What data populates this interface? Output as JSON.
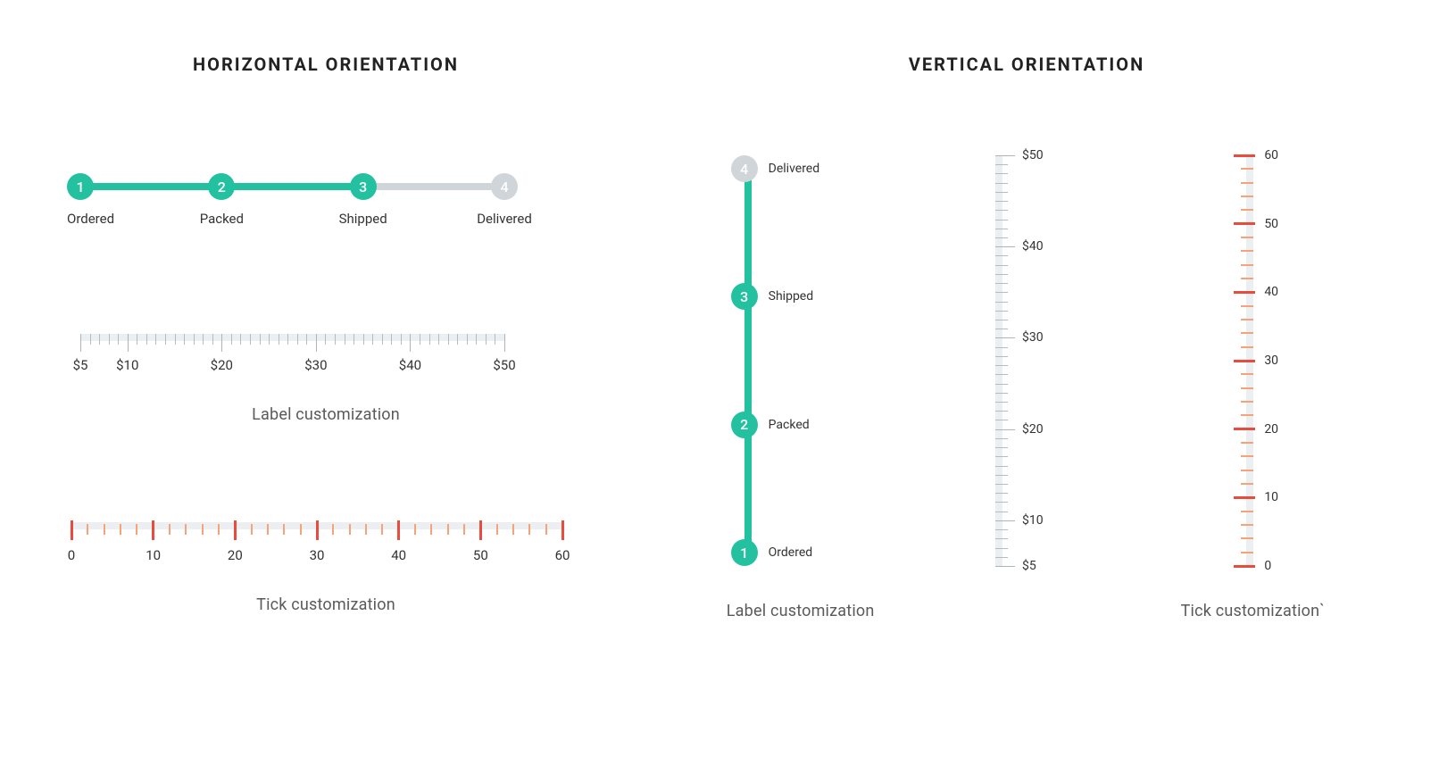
{
  "titles": {
    "horizontal": "HORIZONTAL ORIENTATION",
    "vertical": "VERTICAL ORIENTATION"
  },
  "captions": {
    "labelCustom": "Label customization",
    "tickCustom": "Tick customization",
    "tickCustomBacktick": "Tick customization`"
  },
  "stepperH": {
    "activeIndex": 3,
    "steps": [
      {
        "num": "1",
        "label": "Ordered"
      },
      {
        "num": "2",
        "label": "Packed"
      },
      {
        "num": "3",
        "label": "Shipped"
      },
      {
        "num": "4",
        "label": "Delivered"
      }
    ]
  },
  "rulerH_labels": [
    "$5",
    "$10",
    "$20",
    "$30",
    "$40",
    "$50"
  ],
  "rulerH_values": [
    5,
    10,
    20,
    30,
    40,
    50
  ],
  "rulerH_range": [
    5,
    50
  ],
  "rulerH2_labels": [
    "0",
    "10",
    "20",
    "30",
    "40",
    "50",
    "60"
  ],
  "rulerH2_values": [
    0,
    10,
    20,
    30,
    40,
    50,
    60
  ],
  "rulerH2_range": [
    0,
    60
  ],
  "stepperV": {
    "activeIndex": 3,
    "steps": [
      {
        "num": "4",
        "label": "Delivered"
      },
      {
        "num": "3",
        "label": "Shipped"
      },
      {
        "num": "2",
        "label": "Packed"
      },
      {
        "num": "1",
        "label": "Ordered"
      }
    ]
  },
  "vruler_labels": [
    "$50",
    "$40",
    "$30",
    "$20",
    "$10",
    "$5"
  ],
  "vruler_values": [
    50,
    40,
    30,
    20,
    10,
    5
  ],
  "vruler_range": [
    5,
    50
  ],
  "vruler2_labels": [
    "60",
    "50",
    "40",
    "30",
    "20",
    "10",
    "0"
  ],
  "vruler2_values": [
    60,
    50,
    40,
    30,
    20,
    10,
    0
  ],
  "vruler2_range": [
    0,
    60
  ],
  "colors": {
    "activeStep": "#24c1a0",
    "inactiveStep": "#cfd5d9",
    "tickMajor": "#e74c3c",
    "tickMinor": "#f7a37a",
    "ruleBar": "#eceff1"
  }
}
